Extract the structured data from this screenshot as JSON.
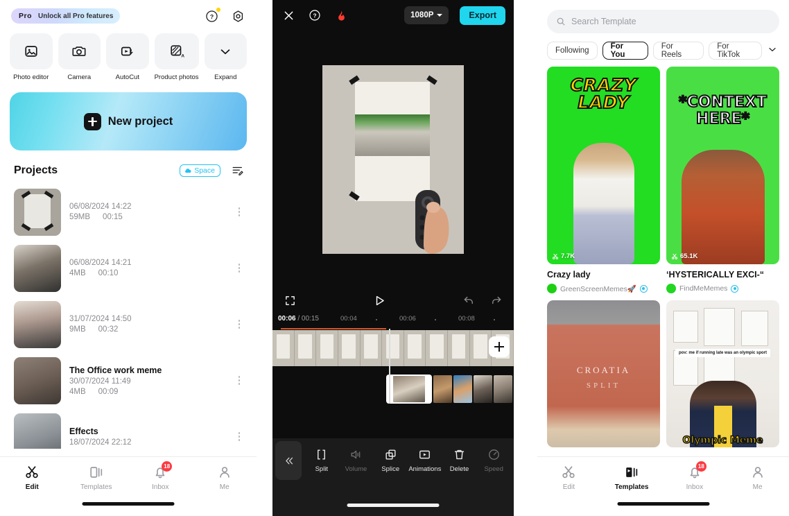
{
  "panel_edit": {
    "promo": {
      "badge": "Pro",
      "text": "Unlock all Pro features"
    },
    "top_icons": [
      {
        "name": "help-icon",
        "glyph": "?"
      },
      {
        "name": "settings-icon",
        "glyph": "gear"
      }
    ],
    "tools": [
      {
        "label": "Photo editor",
        "icon": "image-edit-icon"
      },
      {
        "label": "Camera",
        "icon": "camera-icon"
      },
      {
        "label": "AutoCut",
        "icon": "autocut-icon"
      },
      {
        "label": "Product photos",
        "icon": "product-ai-icon"
      },
      {
        "label": "Expand",
        "icon": "chevron-down-icon"
      }
    ],
    "new_project": {
      "label": "New project"
    },
    "projects_header": {
      "title": "Projects",
      "space_label": "Space",
      "sort_icon": "sort-edit-icon"
    },
    "projects": [
      {
        "name": "",
        "date": "06/08/2024 14:22",
        "size": "59MB",
        "duration": "00:15",
        "thumb": "th-paper"
      },
      {
        "name": "",
        "date": "06/08/2024 14:21",
        "size": "4MB",
        "duration": "00:10",
        "thumb": "th-woman1"
      },
      {
        "name": "",
        "date": "31/07/2024 14:50",
        "size": "9MB",
        "duration": "00:32",
        "thumb": "th-woman2"
      },
      {
        "name": "The Office work meme",
        "date": "30/07/2024 11:49",
        "size": "4MB",
        "duration": "00:09",
        "thumb": "th-office"
      },
      {
        "name": "Effects",
        "date": "18/07/2024 22:12",
        "size": "",
        "duration": "",
        "thumb": "th-effects"
      }
    ],
    "nav": [
      {
        "label": "Edit",
        "icon": "scissors-icon",
        "active": true
      },
      {
        "label": "Templates",
        "icon": "templates-icon",
        "active": false
      },
      {
        "label": "Inbox",
        "icon": "bell-icon",
        "active": false,
        "badge": "18"
      },
      {
        "label": "Me",
        "icon": "person-icon",
        "active": false
      }
    ]
  },
  "panel_editor": {
    "topbar": {
      "close_icon": "close-icon",
      "help_icon": "help-icon",
      "flame_icon": "flame-icon",
      "resolution": "1080P",
      "export_label": "Export"
    },
    "controls": {
      "fullscreen_icon": "fullscreen-icon",
      "play_icon": "play-icon",
      "undo_icon": "undo-icon",
      "redo_icon": "redo-icon"
    },
    "timeline": {
      "current_time": "00:06",
      "total_time": "00:15",
      "ticks": [
        "00:04",
        "00:06",
        "00:08"
      ],
      "add_clip_icon": "plus-icon"
    },
    "toolbar": {
      "collapse_icon": "chevron-left-double-icon",
      "items": [
        {
          "label": "Split",
          "icon": "split-icon",
          "enabled": true
        },
        {
          "label": "Volume",
          "icon": "volume-icon",
          "enabled": false
        },
        {
          "label": "Splice",
          "icon": "splice-icon",
          "enabled": true
        },
        {
          "label": "Animations",
          "icon": "animations-icon",
          "enabled": true
        },
        {
          "label": "Delete",
          "icon": "trash-icon",
          "enabled": true
        },
        {
          "label": "Speed",
          "icon": "speed-icon",
          "enabled": false
        }
      ]
    }
  },
  "panel_templates": {
    "search": {
      "placeholder": "Search Template",
      "icon": "search-icon"
    },
    "tabs": [
      {
        "label": "Following",
        "active": false
      },
      {
        "label": "For You",
        "active": true
      },
      {
        "label": "For Reels",
        "active": false
      },
      {
        "label": "For TikTok",
        "active": false
      }
    ],
    "tabs_more_icon": "chevron-down-icon",
    "cards": [
      {
        "overlay_text": "CRAZY\nLADY",
        "uses": "7.7K",
        "title": "Crazy lady",
        "author": "GreenScreenMemes🚀",
        "avatar_color": "#1ed014",
        "verified": true
      },
      {
        "overlay_text": "*CONTEXT\nHERE*",
        "uses": "65.1K",
        "title": "‘HYSTERICALLY EXCI-“",
        "author": "FindMeMemes",
        "avatar_color": "#22d622",
        "verified": true
      },
      {
        "overlay_text": "CROATIA",
        "overlay_text2": "SPLIT",
        "uses": "",
        "title": "",
        "author": "",
        "avatar_color": "",
        "verified": false
      },
      {
        "overlay_text": "pov: me if running late was an olympic sport",
        "overlay_text2": "Olympic Meme",
        "uses": "",
        "title": "",
        "author": "",
        "avatar_color": "",
        "verified": false
      }
    ],
    "nav": [
      {
        "label": "Edit",
        "icon": "scissors-icon",
        "active": false
      },
      {
        "label": "Templates",
        "icon": "templates-icon",
        "active": true
      },
      {
        "label": "Inbox",
        "icon": "bell-icon",
        "active": false,
        "badge": "18"
      },
      {
        "label": "Me",
        "icon": "person-icon",
        "active": false
      }
    ]
  }
}
